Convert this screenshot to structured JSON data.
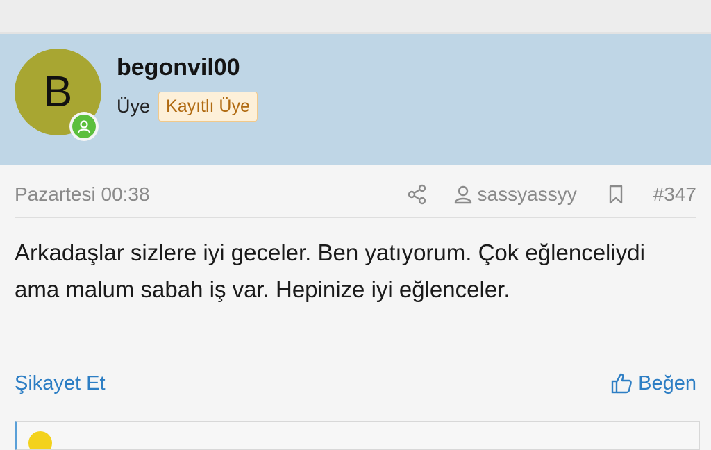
{
  "post": {
    "user": {
      "avatar_letter": "B",
      "username": "begonvil00",
      "role": "Üye",
      "badge": "Kayıtlı Üye",
      "avatar_color": "#a8a632",
      "online_color": "#5cbf3d"
    },
    "meta": {
      "time": "Pazartesi 00:38",
      "author_mention": "sassyassyy",
      "post_number": "#347"
    },
    "body": "Arkadaşlar sizlere iyi geceler. Ben yatıyorum. Çok eğlenceliydi ama malum sabah iş var. Hepinize iyi eğlenceler.",
    "actions": {
      "report": "Şikayet Et",
      "like": "Beğen"
    }
  },
  "icons": {
    "share": "share-icon",
    "user": "user-icon",
    "bookmark": "bookmark-icon",
    "like": "thumbs-up-icon"
  },
  "colors": {
    "header_bg": "#bfd6e6",
    "link": "#2d7ec4",
    "badge_text": "#b06a11"
  }
}
